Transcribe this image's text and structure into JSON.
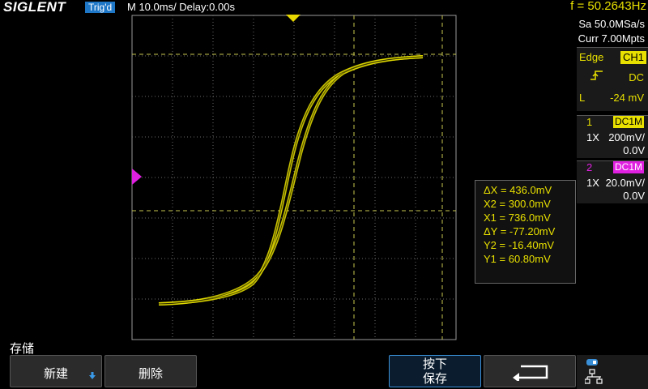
{
  "header": {
    "brand": "SIGLENT",
    "trig_status": "Trig'd",
    "timebase": "M 10.0ms/ Delay:0.00s",
    "frequency": "f = 50.2643Hz"
  },
  "acquisition": {
    "sample_rate": "Sa 50.0MSa/s",
    "memory_depth": "Curr 7.00Mpts"
  },
  "trigger": {
    "type": "Edge",
    "source": "CH1",
    "slope_icon": "rising-edge-icon",
    "coupling": "DC",
    "level_label": "L",
    "level": "-24 mV"
  },
  "channels": [
    {
      "number": "1",
      "coupling": "DC1M",
      "probe": "1X",
      "scale": "200mV/",
      "offset": "0.0V",
      "color": "#e8e000"
    },
    {
      "number": "2",
      "coupling": "DC1M",
      "probe": "1X",
      "scale": "20.0mV/",
      "offset": "0.0V",
      "color": "#e020e0"
    }
  ],
  "cursors": {
    "dx": "ΔX = 436.0mV",
    "x2": "X2 = 300.0mV",
    "x1": "X1 = 736.0mV",
    "dy": "ΔY = -77.20mV",
    "y2": "Y2 = -16.40mV",
    "y1": "Y1 = 60.80mV"
  },
  "menu": {
    "title": "存储",
    "new_label": "新建",
    "delete_label": "删除",
    "press_save_line1": "按下",
    "press_save_line2": "保存",
    "back_icon": "return-arrow-icon",
    "network_icon": "network-icon"
  },
  "colors": {
    "trace": "#e8e000",
    "ch2": "#e020e0",
    "accent": "#1f77c8"
  }
}
